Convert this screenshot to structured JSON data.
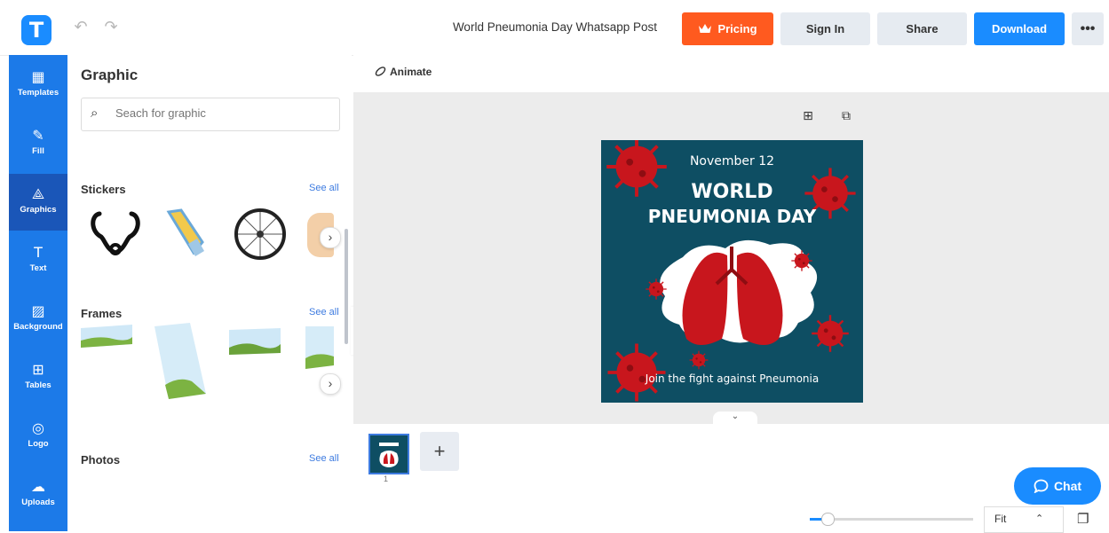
{
  "app": {
    "logo_letter": "T",
    "brand_color": "#1a8cff",
    "orange": "#ff5a1f"
  },
  "header": {
    "undo_icon": "↶",
    "redo_icon": "↷",
    "title": "World Pneumonia Day Whatsapp Post",
    "pricing": "Pricing",
    "pricing_icon": "crown-icon",
    "signin": "Sign In",
    "share": "Share",
    "download": "Download",
    "more": "•••"
  },
  "sidebar": {
    "items": [
      {
        "label": "Templates",
        "icon": "templates-icon",
        "glyph": "▦"
      },
      {
        "label": "Fill",
        "icon": "pencil-icon",
        "glyph": "✎"
      },
      {
        "label": "Graphics",
        "icon": "shapes-icon",
        "glyph": "⟁"
      },
      {
        "label": "Text",
        "icon": "text-icon",
        "glyph": "T"
      },
      {
        "label": "Background",
        "icon": "background-icon",
        "glyph": "▨"
      },
      {
        "label": "Tables",
        "icon": "table-icon",
        "glyph": "⊞"
      },
      {
        "label": "Logo",
        "icon": "logo-icon",
        "glyph": "◎"
      },
      {
        "label": "Uploads",
        "icon": "cloud-upload-icon",
        "glyph": "☁"
      }
    ]
  },
  "panel": {
    "title": "Graphic",
    "search_placeholder": "Seach for graphic",
    "sections": {
      "stickers": {
        "title": "Stickers",
        "see_all": "See all"
      },
      "frames": {
        "title": "Frames",
        "see_all": "See all"
      },
      "photos": {
        "title": "Photos",
        "see_all": "See all"
      }
    }
  },
  "toolbar": {
    "animate": "Animate"
  },
  "poster": {
    "date": "November 12",
    "title_line1": "WORLD",
    "title_line2": "PNEUMONIA DAY",
    "tagline": "Join the fight against Pneumonia",
    "bg_color": "#0e4e63",
    "virus_color": "#c8161d"
  },
  "pages": {
    "page_number": "1",
    "add": "+"
  },
  "chat": {
    "label": "Chat"
  },
  "zoom": {
    "fit_label": "Fit",
    "level_fraction": 0.08
  }
}
